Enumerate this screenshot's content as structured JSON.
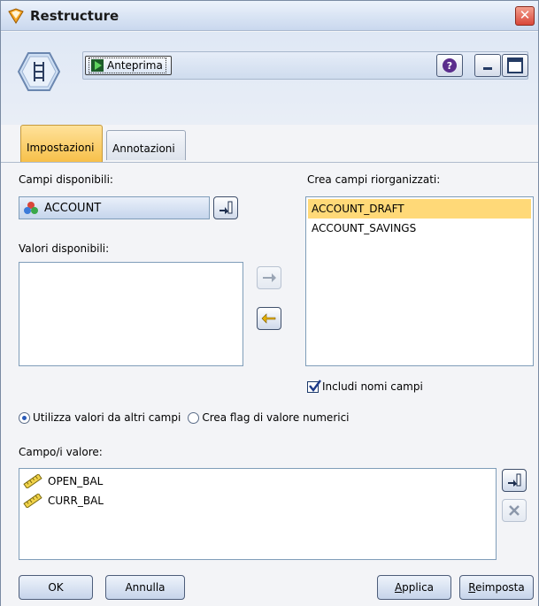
{
  "window": {
    "title": "Restructure",
    "close_label": "✕"
  },
  "toolbar": {
    "preview_label": "Anteprima",
    "help_label": "?"
  },
  "tabs": [
    {
      "label": "Impostazioni",
      "active": true
    },
    {
      "label": "Annotazioni",
      "active": false
    }
  ],
  "settings": {
    "available_fields_label": "Campi disponibili:",
    "selected_field": "ACCOUNT",
    "available_values_label": "Valori disponibili:",
    "available_values": [],
    "create_fields_label": "Crea campi riorganizzati:",
    "restructured_fields": [
      {
        "name": "ACCOUNT_DRAFT",
        "selected": true
      },
      {
        "name": "ACCOUNT_SAVINGS",
        "selected": false
      }
    ],
    "include_field_names_label": "Includi nomi campi",
    "include_field_names_checked": true,
    "radio_use_values_label": "Utilizza valori da altri campi",
    "radio_use_values_checked": true,
    "radio_create_flags_label": "Crea flag di valore numerici",
    "radio_create_flags_checked": false,
    "value_fields_label": "Campo/i valore:",
    "value_fields": [
      "OPEN_BAL",
      "CURR_BAL"
    ]
  },
  "buttons": {
    "ok": "OK",
    "cancel": "Annulla",
    "apply_prefix": "",
    "apply_underline": "A",
    "apply_rest": "pplica",
    "reset_underline": "R",
    "reset_rest": "eimposta"
  },
  "colors": {
    "active_tab": "#f7c04a",
    "selected_row": "#ffd978",
    "title_gradient_bottom": "#c9d8ee"
  }
}
